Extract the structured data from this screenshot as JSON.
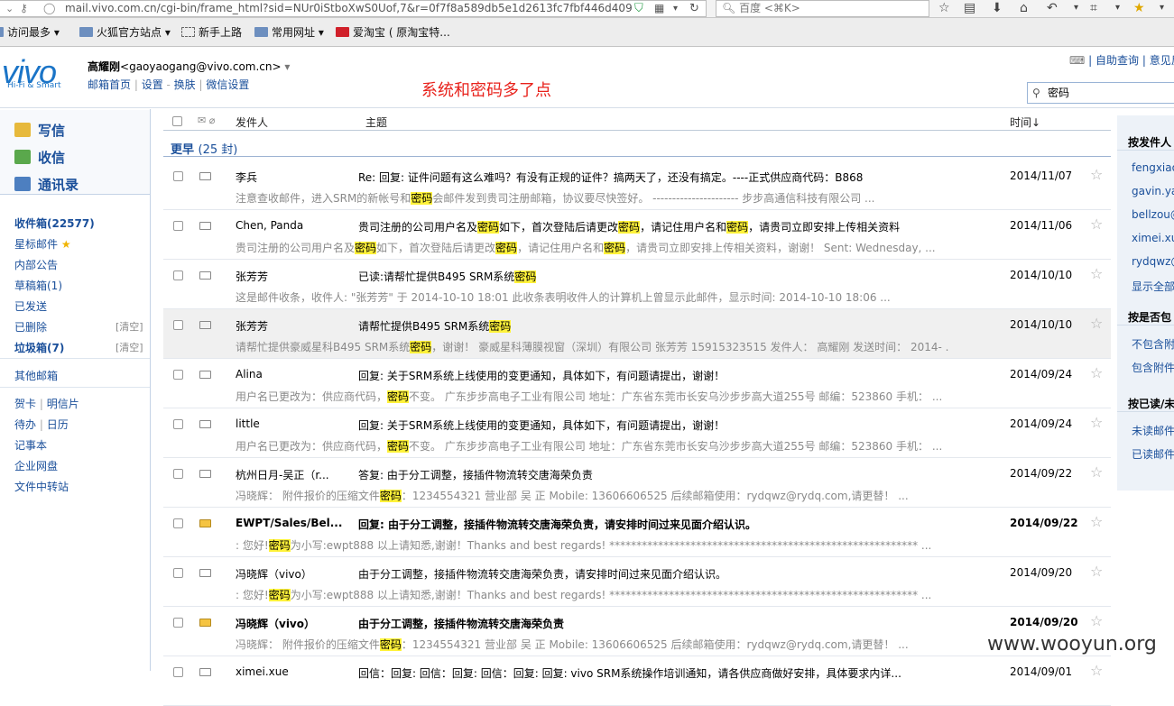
{
  "browser": {
    "url": "mail.vivo.com.cn/cgi-bin/frame_html?sid=NUr0iStboXwS0Uof,7&r=0f7f8a589db5e1d2613fc7fbf446d409",
    "search_placeholder": "百度 <⌘K>",
    "bookmarks": [
      "访问最多",
      "火狐官方站点",
      "新手上路",
      "常用网址",
      "爱淘宝 ( 原淘宝特..."
    ]
  },
  "header": {
    "user_name": "高耀刚",
    "user_email": "<gaoyaogang@vivo.com.cn>",
    "links": [
      "邮箱首页",
      "设置",
      "换肤",
      "微信设置"
    ],
    "top_links": [
      "自助查询",
      "意见反"
    ],
    "annotation": "系统和密码多了点",
    "search_value": "密码",
    "logo_text": "vivo",
    "logo_sub": "Hi-Fi & Smart"
  },
  "actions": [
    "写信",
    "收信",
    "通讯录"
  ],
  "folders": {
    "inbox": "收件箱(22577)",
    "starred": "星标邮件",
    "announce": "内部公告",
    "drafts": "草稿箱(1)",
    "sent": "已发送",
    "deleted": "已删除",
    "spam": "垃圾箱(7)",
    "clear": "[清空]",
    "others": "其他邮箱",
    "card": "贺卡",
    "postcard": "明信片",
    "todo": "待办",
    "calendar": "日历",
    "notes": "记事本",
    "netdisk": "企业网盘",
    "transfer": "文件中转站"
  },
  "columns": {
    "sender": "发件人",
    "subject": "主题",
    "time": "时间↓"
  },
  "group": {
    "label": "更早",
    "count": "(25 封)"
  },
  "keyword": "密码",
  "emails": [
    {
      "sender": "李兵",
      "subject": "Re: 回复: 证件问题有这么难吗？有没有正规的证件？搞两天了，还没有搞定。----正式供应商代码：B868",
      "preview": "注意查收邮件，进入SRM的新帐号和密码会邮件发到贵司注册邮箱，协议要尽快签好。 ---------------------- 步步高通信科技有限公司 ...",
      "date": "2014/11/07",
      "unread": false
    },
    {
      "sender": "Chen, Panda",
      "subject": "贵司注册的公司用户名及密码如下，首次登陆后请更改密码，请记住用户名和密码，请贵司立即安排上传相关资料",
      "preview": "贵司注册的公司用户名及密码如下，首次登陆后请更改密码，请记住用户名和密码，请贵司立即安排上传相关资料，谢谢！ Sent: Wednesday, ...",
      "date": "2014/11/06",
      "unread": false
    },
    {
      "sender": "张芳芳",
      "subject": "已读:请帮忙提供B495 SRM系统密码",
      "preview": "这是邮件收条，收件人: \"张芳芳\" 于 2014-10-10 18:01 此收条表明收件人的计算机上曾显示此邮件，显示时间: 2014-10-10 18:06 ...",
      "date": "2014/10/10",
      "unread": false
    },
    {
      "sender": "张芳芳",
      "subject": "请帮忙提供B495 SRM系统密码",
      "preview": "请帮忙提供豪威星科B495 SRM系统密码，谢谢！ 豪威星科薄膜视窗（深圳）有限公司 张芳芳 15915323515 发件人： 高耀刚 发送时间： 2014- ...",
      "date": "2014/10/10",
      "unread": false
    },
    {
      "sender": "Alina",
      "subject": "回复: 关于SRM系统上线使用的变更通知，具体如下，有问题请提出，谢谢！",
      "preview": "用户名已更改为：供应商代码，密码不变。 广东步步高电子工业有限公司 地址：广东省东莞市长安乌沙步步高大道255号 邮编：523860 手机： ...",
      "date": "2014/09/24",
      "unread": false
    },
    {
      "sender": "little",
      "subject": "回复: 关于SRM系统上线使用的变更通知，具体如下，有问题请提出，谢谢！",
      "preview": "用户名已更改为：供应商代码，密码不变。 广东步步高电子工业有限公司 地址：广东省东莞市长安乌沙步步高大道255号 邮编：523860 手机： ...",
      "date": "2014/09/24",
      "unread": false
    },
    {
      "sender": "杭州日月-吴正（r...",
      "subject": "答复: 由于分工调整，接插件物流转交唐海荣负责",
      "preview": "冯晓辉： 附件报价的压缩文件密码：1234554321 营业部 吴 正 Mobile: 13606606525 后续邮箱使用：rydqwz@rydq.com,请更替！ ...",
      "date": "2014/09/22",
      "unread": false
    },
    {
      "sender": "EWPT/Sales/Bel...",
      "subject": "回复: 由于分工调整，接插件物流转交唐海荣负责，请安排时间过来见面介绍认识。",
      "preview": ": 您好!密码为小写:ewpt888 以上请知悉,谢谢！Thanks and best regards! ********************************************************* ...",
      "date": "2014/09/22",
      "unread": true
    },
    {
      "sender": "冯晓辉（vivo）",
      "subject": "由于分工调整，接插件物流转交唐海荣负责，请安排时间过来见面介绍认识。",
      "preview": ": 您好!密码为小写:ewpt888 以上请知悉,谢谢！Thanks and best regards! ********************************************************* ...",
      "date": "2014/09/20",
      "unread": false
    },
    {
      "sender": "冯晓辉（vivo）",
      "subject": "由于分工调整，接插件物流转交唐海荣负责",
      "preview": "冯晓辉： 附件报价的压缩文件密码：1234554321 营业部 吴 正 Mobile: 13606606525 后续邮箱使用：rydqwz@rydq.com,请更替！ ...",
      "date": "2014/09/20",
      "unread": true
    },
    {
      "sender": "ximei.xue",
      "subject": "回信：回复: 回信：回复: 回信：回复: 回复: vivo SRM系统操作培训通知，请各供应商做好安排，具体要求内详...",
      "preview": "",
      "date": "2014/09/01",
      "unread": false
    }
  ],
  "filters": {
    "by_sender": "按发件人",
    "senders": [
      "fengxiao",
      "gavin.ya",
      "bellzou@",
      "ximei.xu",
      "rydqwz@",
      "显示全部"
    ],
    "by_attach": "按是否包",
    "attach": [
      "不包含附",
      "包含附件"
    ],
    "by_read": "按已读/未",
    "read": [
      "未读邮件",
      "已读邮件"
    ]
  },
  "watermark": "www.wooyun.org"
}
